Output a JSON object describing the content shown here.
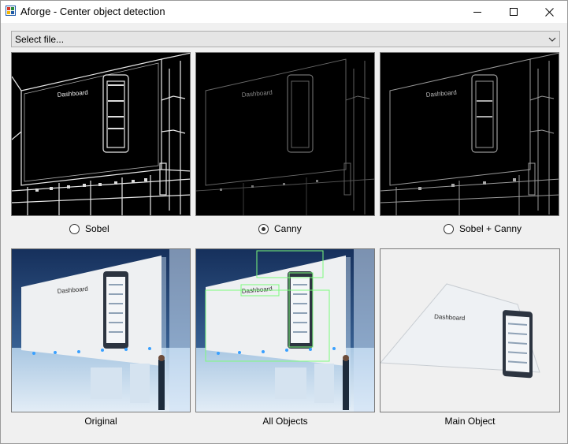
{
  "window": {
    "title": "Aforge - Center object detection",
    "minimize_icon": "minimize-icon",
    "maximize_icon": "maximize-icon",
    "close_icon": "close-icon"
  },
  "file_combo": {
    "value": "Select file...",
    "arrow_icon": "chevron-down-icon"
  },
  "images": {
    "sobel": "Sobel edge image",
    "canny": "Canny edge image",
    "sobel_canny": "Sobel + Canny edge image",
    "original": "Original photo",
    "all_objects": "All Objects detection photo",
    "main_object": "Main Object extracted photo",
    "screen_text": "Dashboard"
  },
  "filters": [
    {
      "label": "Sobel",
      "checked": false
    },
    {
      "label": "Canny",
      "checked": true
    },
    {
      "label": "Sobel + Canny",
      "checked": false
    }
  ],
  "captions": {
    "original": "Original",
    "all_objects": "All Objects",
    "main_object": "Main Object"
  },
  "colors": {
    "detection_box": "#7cfc7c",
    "window_bg": "#f0f0f0",
    "titlebar_bg": "#ffffff"
  }
}
